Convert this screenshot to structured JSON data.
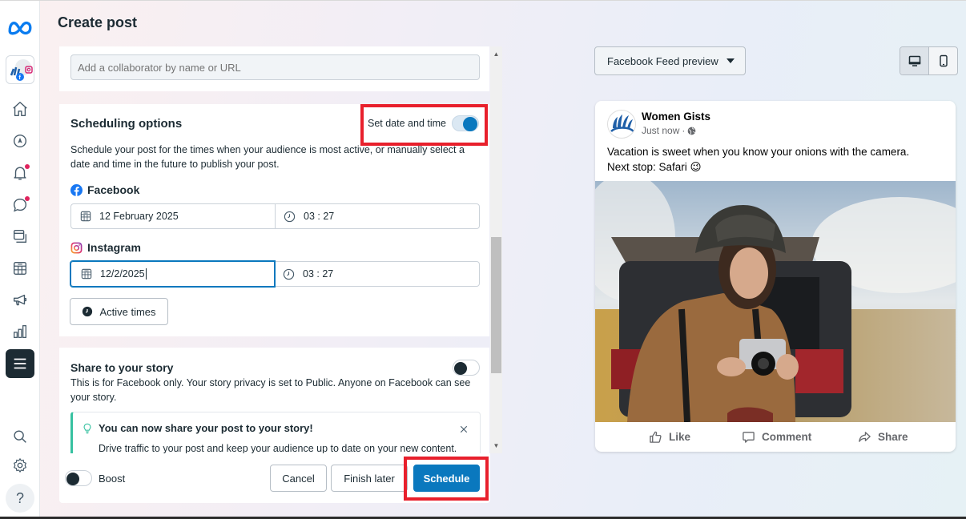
{
  "page": {
    "title": "Create post"
  },
  "sidebar": {
    "items": [
      {
        "name": "meta-logo"
      },
      {
        "name": "account-avatar"
      },
      {
        "name": "home"
      },
      {
        "name": "navigate"
      },
      {
        "name": "notifications",
        "badge": true
      },
      {
        "name": "messages",
        "badge": true
      },
      {
        "name": "content"
      },
      {
        "name": "planner"
      },
      {
        "name": "ads"
      },
      {
        "name": "insights"
      },
      {
        "name": "all-tools",
        "active": true
      },
      {
        "name": "search"
      },
      {
        "name": "settings"
      },
      {
        "name": "help",
        "label": "?"
      }
    ]
  },
  "collaborator": {
    "placeholder": "Add a collaborator by name or URL"
  },
  "scheduling": {
    "title": "Scheduling options",
    "toggle_label": "Set date and time",
    "toggle_on": true,
    "description_line1": "Schedule your post for the times when your audience is most active, or manually select a",
    "description_line2": "date and time in the future to publish your post.",
    "facebook": {
      "label": "Facebook",
      "date": "12 February 2025",
      "time": "03 : 27"
    },
    "instagram": {
      "label": "Instagram",
      "date": "12/2/2025",
      "time": "03 : 27"
    },
    "active_times_label": "Active times"
  },
  "story": {
    "title": "Share to your story",
    "toggle_on": false,
    "description_line1": "This is for Facebook only. Your story privacy is set to Public. Anyone on Facebook can see",
    "description_line2": "your story.",
    "tip_title": "You can now share your post to your story!",
    "tip_text": "Drive traffic to your post and keep your audience up to date on your new content."
  },
  "footer": {
    "boost_label": "Boost",
    "boost_on": false,
    "cancel_label": "Cancel",
    "finish_later_label": "Finish later",
    "schedule_label": "Schedule"
  },
  "preview": {
    "selector_label": "Facebook Feed preview",
    "device_selected": "desktop",
    "post": {
      "page_name": "Women Gists",
      "timestamp": "Just now",
      "separator": "·",
      "text_line1": "Vacation is sweet when you know your onions with the camera.",
      "text_line2": "Next stop: Safari 😉",
      "image_alt": "Woman in hat holding a camera in front of an SUV on safari",
      "actions": {
        "like": "Like",
        "comment": "Comment",
        "share": "Share"
      }
    }
  },
  "colors": {
    "accent": "#0a78be",
    "highlight": "#e8202c",
    "dark": "#1c2b33",
    "notification_dot": "#e0245e"
  }
}
